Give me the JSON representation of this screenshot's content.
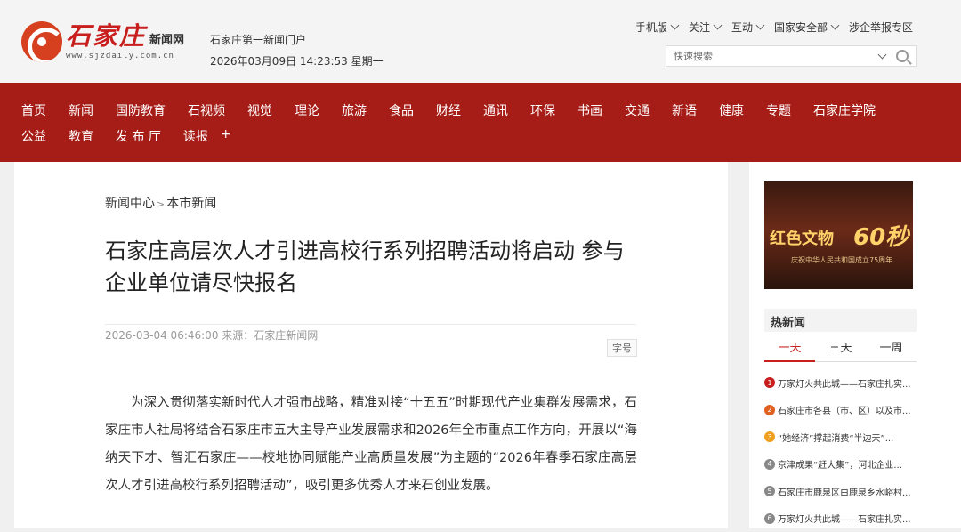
{
  "header": {
    "logo_cn": "石家庄",
    "logo_sub": "新闻网",
    "logo_url": "www.sjzdaily.com.cn",
    "slogan": "石家庄第一新闻门户",
    "datetime": "2026年03月09日 14:23:53 星期一",
    "top_links": [
      "手机版",
      "关注",
      "互动",
      "国家安全部",
      "涉企举报专区"
    ],
    "search_placeholder": "快速搜索"
  },
  "nav": {
    "row1": [
      "首页",
      "新闻",
      "国防教育",
      "石视频",
      "视觉",
      "理论",
      "旅游",
      "食品",
      "财经",
      "通讯",
      "环保",
      "书画",
      "交通",
      "新语",
      "健康",
      "专题",
      "石家庄学院"
    ],
    "row2": [
      "公益",
      "教育",
      "发 布 厅",
      "读报",
      "+"
    ]
  },
  "breadcrumb": {
    "home": "新闻中心",
    "sep": ">",
    "current": "本市新闻"
  },
  "article": {
    "title": "石家庄高层次人才引进高校行系列招聘活动将启动 参与企业单位请尽快报名",
    "meta": "2026-03-04 06:46:00 来源：石家庄新闻网",
    "font_size_label": "字号",
    "body": "为深入贯彻落实新时代人才强市战略，精准对接“十五五”时期现代产业集群发展需求，石家庄市人社局将结合石家庄市五大主导产业发展需求和2026年全市重点工作方向，开展以“海纳天下才、智汇石家庄——校地协同赋能产业高质量发展”为主题的“2026年春季石家庄高层次人才引进高校行系列招聘活动”，吸引更多优秀人才来石创业发展。"
  },
  "sidebar": {
    "banner": {
      "title": "红色文物",
      "number": "60秒",
      "subtitle": "庆祝中华人民共和国成立75周年"
    },
    "hot_title": "热新闻",
    "tabs": [
      "一天",
      "三天",
      "一周"
    ],
    "hot_news": [
      {
        "rank": "1",
        "title": "万家灯火共此城——石家庄扎实..."
      },
      {
        "rank": "2",
        "title": "石家庄市各县（市、区）以及市..."
      },
      {
        "rank": "3",
        "title": "“她经济”撑起消费“半边天”..."
      },
      {
        "rank": "4",
        "title": "京津成果“赶大集”，河北企业..."
      },
      {
        "rank": "5",
        "title": "石家庄市鹿泉区白鹿泉乡水峪村..."
      },
      {
        "rank": "6",
        "title": "万家灯火共此城——石家庄扎实..."
      }
    ]
  },
  "colors": {
    "nav_bg": "#a61c16",
    "brand_red": "#c81e1e"
  }
}
